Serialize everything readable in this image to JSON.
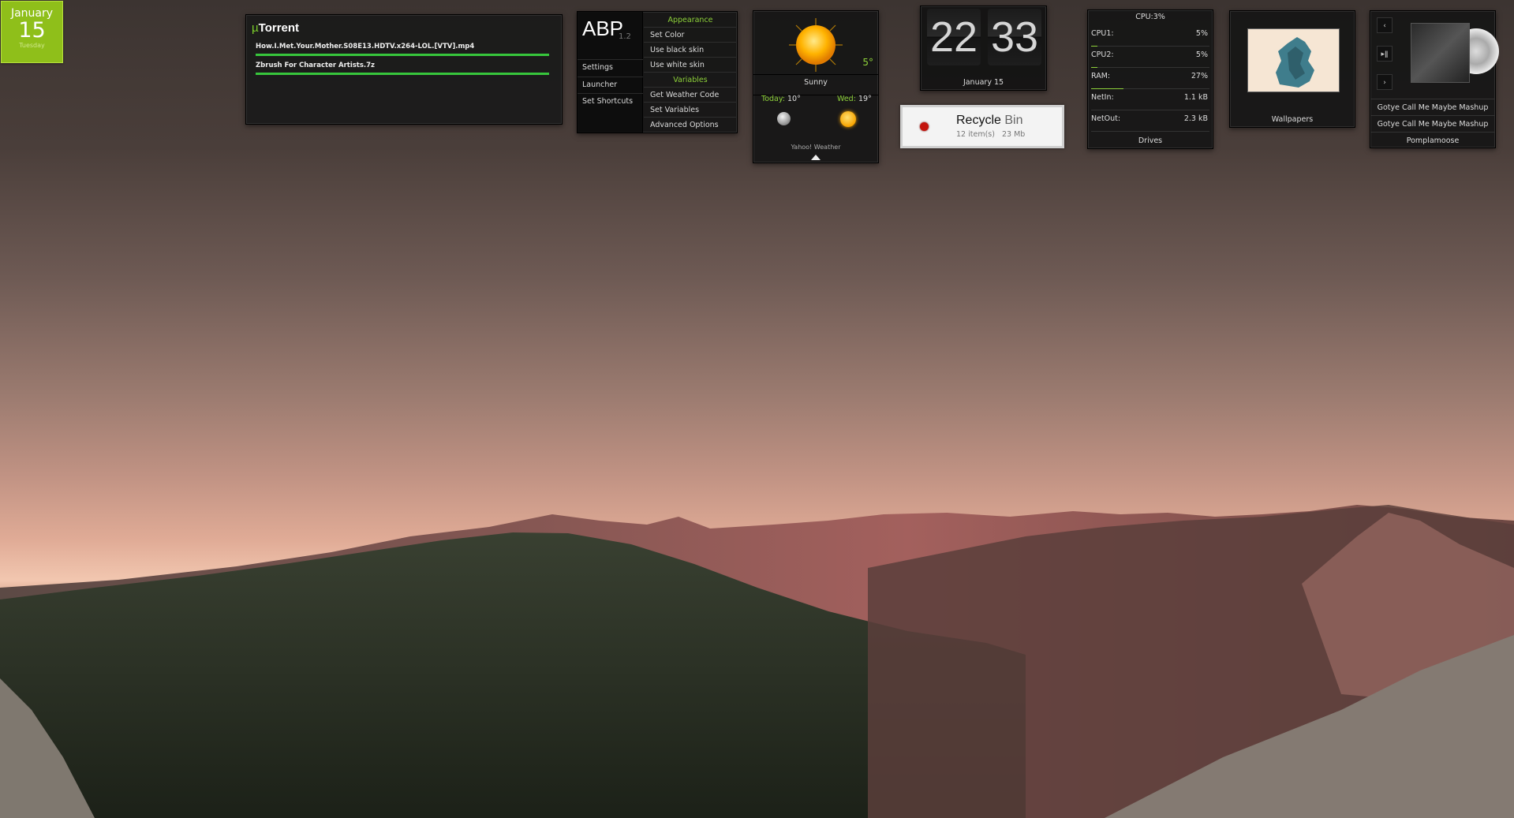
{
  "calendar": {
    "month": "January",
    "day": "15",
    "weekday": "Tuesday"
  },
  "utorrent": {
    "title_mu": "µ",
    "title_rest": "Torrent",
    "items": [
      {
        "name": "How.I.Met.Your.Mother.S08E13.HDTV.x264-LOL.[VTV].mp4",
        "progress": 1.0
      },
      {
        "name": "Zbrush For Character Artists.7z",
        "progress": 1.0
      }
    ]
  },
  "abp": {
    "logo": "ABP",
    "version": "1.2",
    "left_items": [
      "Settings",
      "Launcher",
      "Set Shortcuts"
    ],
    "appearance_header": "Appearance",
    "appearance_items": [
      "Set Color",
      "Use black skin",
      "Use white skin"
    ],
    "variables_header": "Variables",
    "variables_items": [
      "Get Weather Code",
      "Set Variables",
      "Advanced Options"
    ]
  },
  "weather": {
    "temp": "5°",
    "condition": "Sunny",
    "today_label": "Today:",
    "today_temp": "10°",
    "wed_label": "Wed:",
    "wed_temp": "19°",
    "source": "Yahoo! Weather"
  },
  "clock": {
    "hour": "22",
    "minute": "33",
    "date": "January  15"
  },
  "recycle": {
    "title": "Recycle",
    "title2": "Bin",
    "items": "12 item(s)",
    "size": "23 Mb"
  },
  "system": {
    "header": "CPU:3%",
    "rows": [
      {
        "label": "CPU1:",
        "value": "5%",
        "fill": 0.05
      },
      {
        "label": "CPU2:",
        "value": "5%",
        "fill": 0.05
      },
      {
        "label": "RAM:",
        "value": "27%",
        "fill": 0.27
      },
      {
        "label": "NetIn:",
        "value": "1.1 kB",
        "fill": 0.0
      },
      {
        "label": "NetOut:",
        "value": "2.3 kB",
        "fill": 0.0
      }
    ],
    "footer": "Drives"
  },
  "wallpapers": {
    "label": "Wallpapers"
  },
  "music": {
    "prev": "‹",
    "play": "▸ǁ",
    "next": "›",
    "track1": "Gotye Call Me Maybe Mashup",
    "track2": "Gotye Call Me Maybe Mashup",
    "artist": "Pomplamoose"
  },
  "colors": {
    "accent": "#8ed23a",
    "progress": "#37c63c",
    "calendar": "#8fbf1a"
  }
}
